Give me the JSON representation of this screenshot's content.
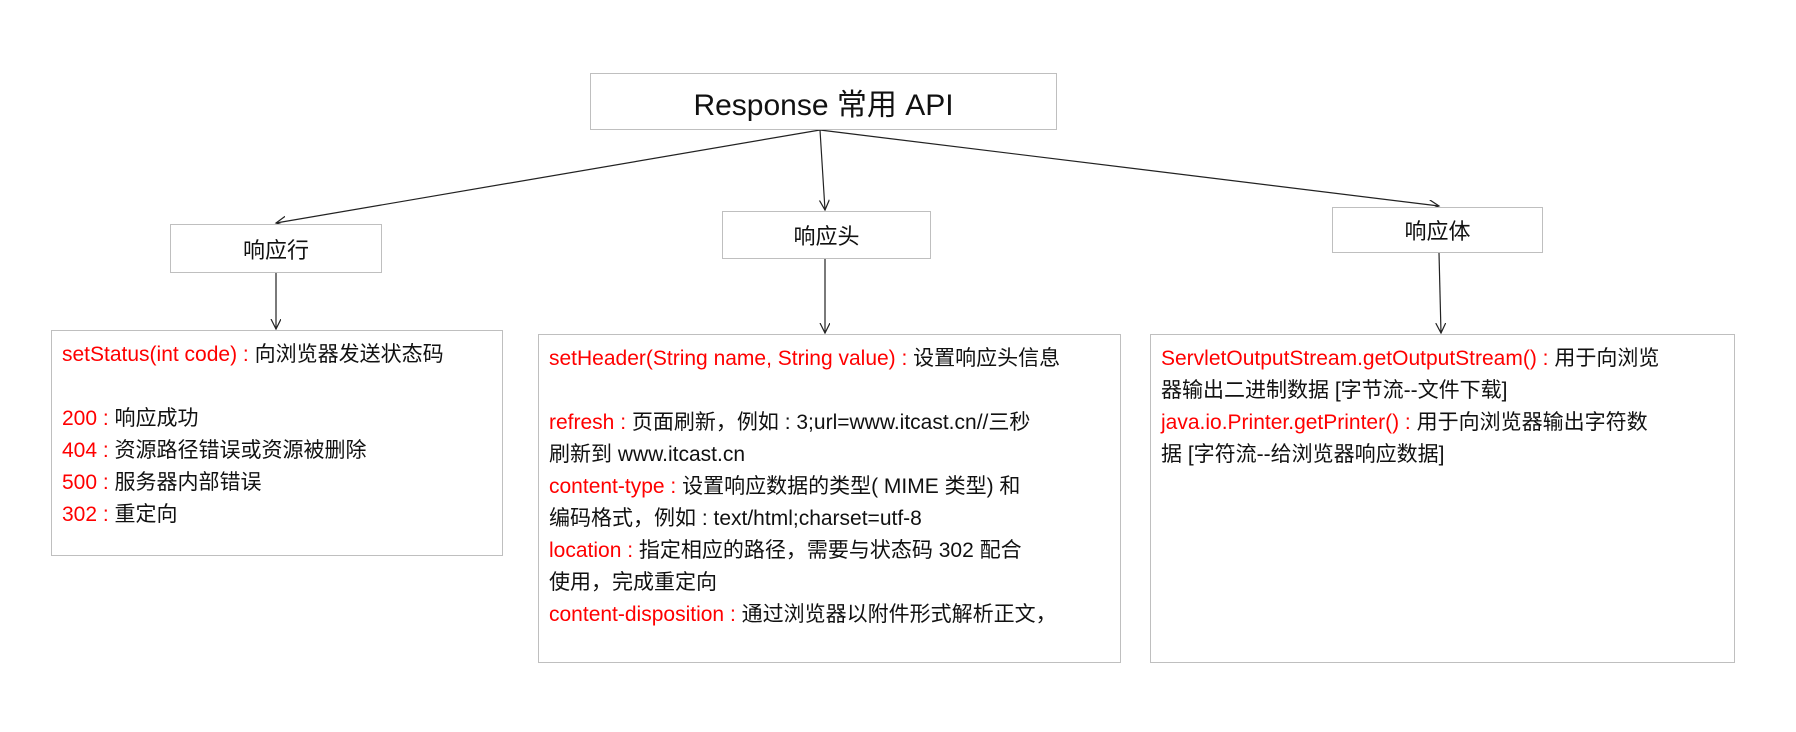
{
  "title": "Response 常用 API",
  "nodes": {
    "line": "响应行",
    "header": "响应头",
    "body": "响应体"
  },
  "details": {
    "line": [
      {
        "k": "setStatus(int code) : ",
        "v": "向浏览器发送状态码"
      },
      {
        "k": "",
        "v": ""
      },
      {
        "k": "200 : ",
        "v": "响应成功"
      },
      {
        "k": "404 : ",
        "v": "资源路径错误或资源被删除"
      },
      {
        "k": "500 : ",
        "v": "服务器内部错误"
      },
      {
        "k": "302 : ",
        "v": "重定向"
      }
    ],
    "header": [
      {
        "k": "setHeader(String name, String value) : ",
        "v": "设置响应头信息"
      },
      {
        "k": "",
        "v": ""
      },
      {
        "k": "refresh : ",
        "v": "页面刷新，例如 : 3;url=www.itcast.cn//三秒"
      },
      {
        "k": "",
        "v": "刷新到 www.itcast.cn"
      },
      {
        "k": "content-type : ",
        "v": "设置响应数据的类型( MIME 类型) 和"
      },
      {
        "k": "",
        "v": "编码格式，例如 : text/html;charset=utf-8"
      },
      {
        "k": "location : ",
        "v": "指定相应的路径，需要与状态码 302 配合"
      },
      {
        "k": "",
        "v": "使用，完成重定向"
      },
      {
        "k": "content-disposition : ",
        "v": "通过浏览器以附件形式解析正文，"
      }
    ],
    "body": [
      {
        "k": "ServletOutputStream.getOutputStream() : ",
        "v": "用于向浏览"
      },
      {
        "k": "",
        "v": "器输出二进制数据 [字节流--文件下载]"
      },
      {
        "k": "java.io.Printer.getPrinter() : ",
        "v": "用于向浏览器输出字符数"
      },
      {
        "k": "",
        "v": "据 [字符流--给浏览器响应数据]"
      }
    ]
  },
  "colors": {
    "key": "#ff0000",
    "text": "#111111",
    "border": "#bfbfbf",
    "arrow": "#222222"
  }
}
